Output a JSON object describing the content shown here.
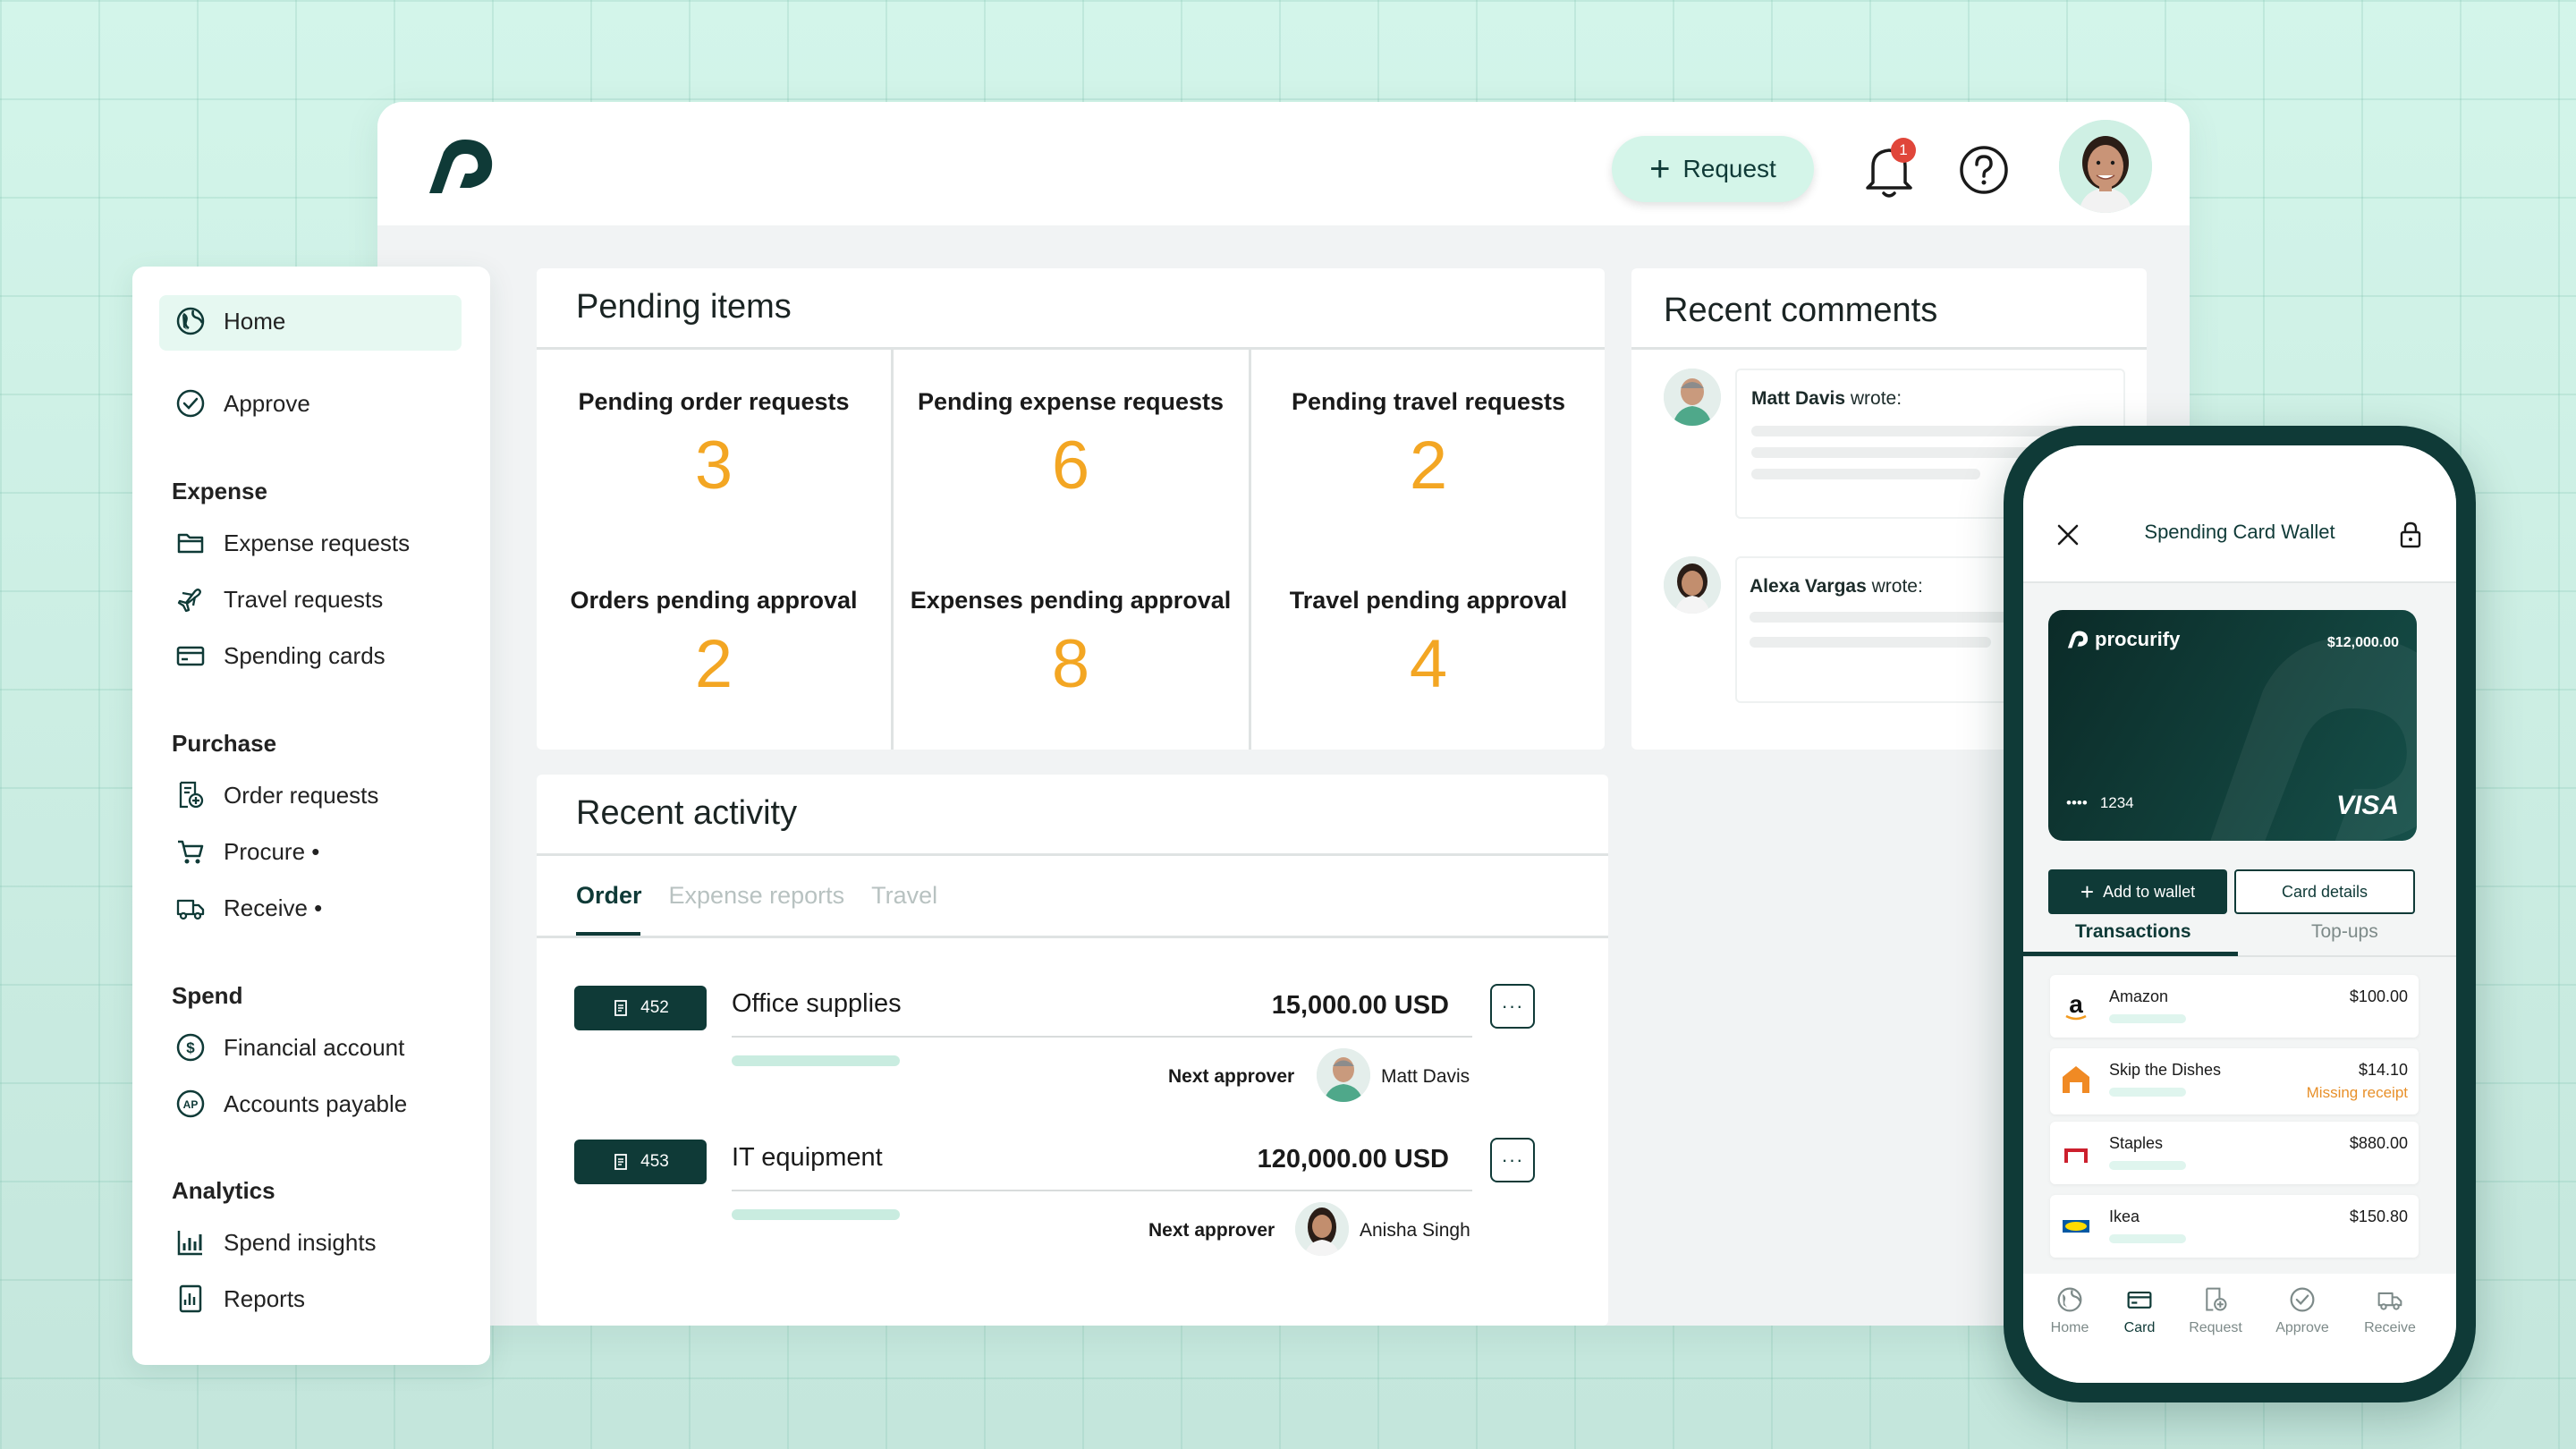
{
  "topbar": {
    "request_label": "Request",
    "notification_count": "1"
  },
  "sidebar": {
    "home": "Home",
    "approve": "Approve",
    "sections": {
      "expense": "Expense",
      "purchase": "Purchase",
      "spend": "Spend",
      "analytics": "Analytics"
    },
    "items": {
      "expense_requests": "Expense requests",
      "travel_requests": "Travel requests",
      "spending_cards": "Spending cards",
      "order_requests": "Order requests",
      "procure": "Procure •",
      "receive": "Receive •",
      "financial_account": "Financial account",
      "accounts_payable": "Accounts payable",
      "spend_insights": "Spend insights",
      "reports": "Reports"
    }
  },
  "pending": {
    "title": "Pending items",
    "cells": [
      {
        "label": "Pending order requests",
        "value": "3"
      },
      {
        "label": "Pending expense requests",
        "value": "6"
      },
      {
        "label": "Pending travel requests",
        "value": "2"
      },
      {
        "label": "Orders pending approval",
        "value": "2"
      },
      {
        "label": "Expenses pending approval",
        "value": "8"
      },
      {
        "label": "Travel pending approval",
        "value": "4"
      }
    ]
  },
  "activity": {
    "title": "Recent activity",
    "tabs": [
      "Order",
      "Expense reports",
      "Travel"
    ],
    "next_approver_label": "Next approver",
    "orders": [
      {
        "id": "452",
        "name": "Office supplies",
        "amount": "15,000.00 USD",
        "approver": "Matt Davis"
      },
      {
        "id": "453",
        "name": "IT equipment",
        "amount": "120,000.00 USD",
        "approver": "Anisha Singh"
      }
    ]
  },
  "comments": {
    "title": "Recent comments",
    "items": [
      {
        "author": "Matt Davis",
        "suffix": " wrote:"
      },
      {
        "author": "Alexa Vargas",
        "suffix": " wrote:"
      }
    ]
  },
  "phone": {
    "title": "Spending Card Wallet",
    "card": {
      "brand": "procurify",
      "balance": "$12,000.00",
      "dots": "••••",
      "last4": "1234",
      "network": "VISA"
    },
    "add_to_wallet": "Add to wallet",
    "card_details": "Card details",
    "tabs": [
      "Transactions",
      "Top-ups"
    ],
    "transactions": [
      {
        "merchant": "Amazon",
        "amount": "$100.00",
        "note": ""
      },
      {
        "merchant": "Skip the Dishes",
        "amount": "$14.10",
        "note": "Missing receipt"
      },
      {
        "merchant": "Staples",
        "amount": "$880.00",
        "note": ""
      },
      {
        "merchant": "Ikea",
        "amount": "$150.80",
        "note": ""
      }
    ],
    "nav": [
      "Home",
      "Card",
      "Request",
      "Approve",
      "Receive"
    ]
  },
  "colors": {
    "brand_dark": "#0f3a37",
    "accent_mint": "#d4f5e9",
    "count_orange": "#f3a623",
    "badge_red": "#e0463a",
    "warning_orange": "#e8902a"
  }
}
